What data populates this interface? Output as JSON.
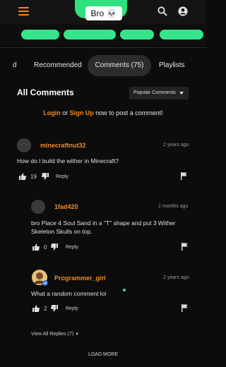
{
  "header": {
    "caption": "Bro 💀",
    "menu_icon": "hamburger-menu-icon",
    "search_icon": "search-icon",
    "account_icon": "account-icon",
    "accent_color": "#f08a24",
    "scribble_color": "#35e58a"
  },
  "tabs": [
    {
      "label": "d",
      "active": false
    },
    {
      "label": "Recommended",
      "active": false
    },
    {
      "label": "Comments (75)",
      "active": true
    },
    {
      "label": "Playlists",
      "active": false
    }
  ],
  "comments_section": {
    "title": "All Comments",
    "sort_selected": "Popular Comments",
    "login_prompt": {
      "login": "Login",
      "or": " or ",
      "signup": "Sign Up",
      "rest": " now to post a comment!"
    }
  },
  "comments": [
    {
      "username": "minecraftnut32",
      "time": "2 years ago",
      "text": "How do I build the wither in Minecraft?",
      "likes": "19",
      "reply_label": "Reply"
    },
    {
      "username": "1fad420",
      "time": "2 months ago",
      "text": "bro Place 4 Soul Sand in a \"T\" shape and put 3 Wither Skeleton Skulls on top.",
      "likes": "0",
      "reply_label": "Reply"
    },
    {
      "username": "Programmer_girl",
      "time": "2 years ago",
      "text": "What a random comment lol",
      "likes": "2",
      "reply_label": "Reply"
    }
  ],
  "view_replies": "View All Replies (7)",
  "load_more": "LOAD MORE"
}
